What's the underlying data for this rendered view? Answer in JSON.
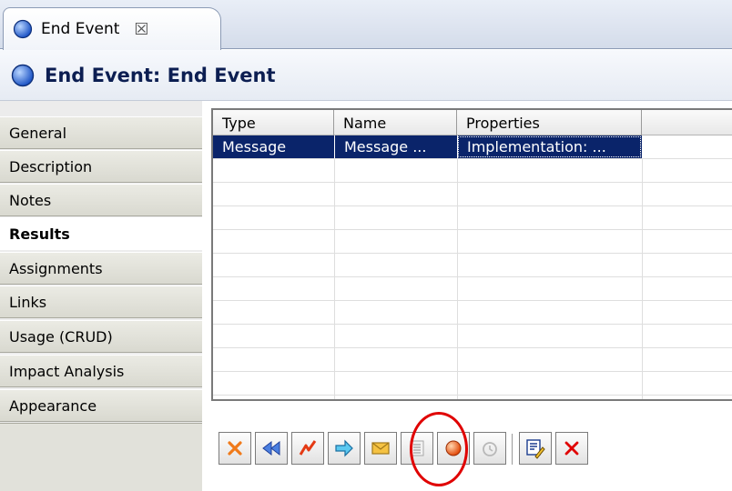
{
  "editor_tab": {
    "title": "End Event",
    "close_glyph": "☒"
  },
  "header": {
    "title": "End Event: End Event"
  },
  "sections": [
    {
      "label": "General"
    },
    {
      "label": "Description"
    },
    {
      "label": "Notes"
    },
    {
      "label": "Results",
      "selected": true
    },
    {
      "label": "Assignments"
    },
    {
      "label": "Links"
    },
    {
      "label": "Usage (CRUD)"
    },
    {
      "label": "Impact Analysis"
    },
    {
      "label": "Appearance"
    }
  ],
  "table": {
    "columns": [
      "Type",
      "Name",
      "Properties",
      ""
    ],
    "rows": [
      {
        "type": "Message",
        "name": "Message ...",
        "properties": "Implementation: ...",
        "extra": "",
        "selected": true
      }
    ]
  },
  "toolbar": {
    "buttons": [
      {
        "icon": "delete-orange-x-icon"
      },
      {
        "icon": "rewind-icon"
      },
      {
        "icon": "error-lightning-icon"
      },
      {
        "icon": "arrow-right-icon"
      },
      {
        "icon": "message-envelope-icon",
        "highlighted": true
      },
      {
        "icon": "list-icon",
        "disabled": true
      },
      {
        "icon": "orange-ball-icon"
      },
      {
        "icon": "timer-icon",
        "disabled": true
      },
      {
        "icon": "edit-properties-icon"
      },
      {
        "icon": "red-x-icon"
      }
    ]
  },
  "colors": {
    "selection": "#0a246a",
    "highlight_circle": "#e00000",
    "title": "#0c1e52"
  }
}
